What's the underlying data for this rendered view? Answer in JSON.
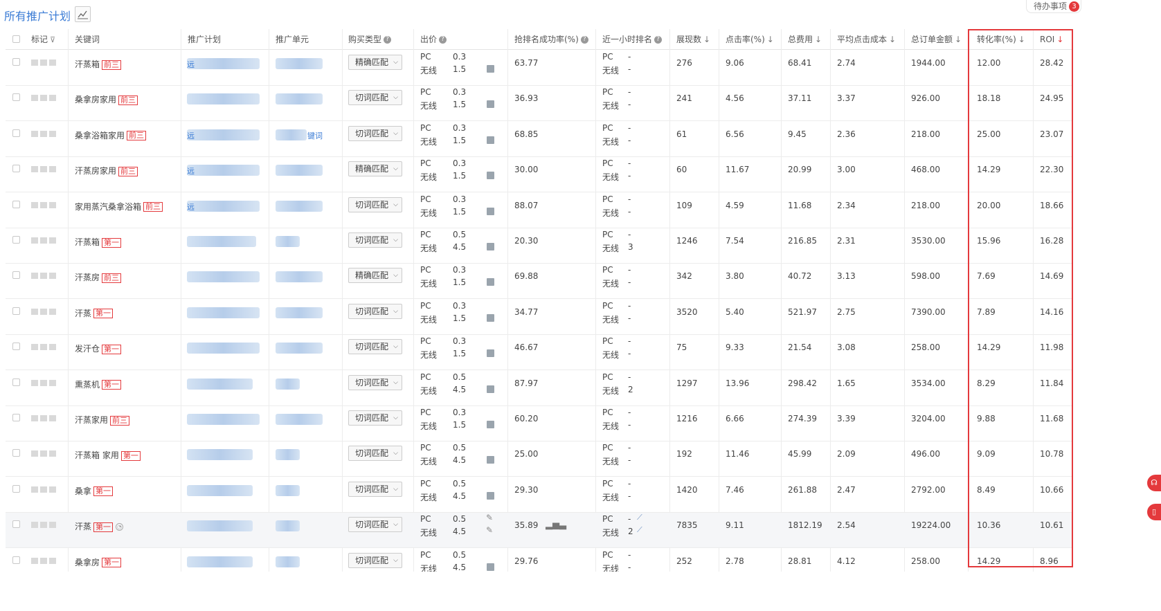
{
  "header": {
    "title": "所有推广计划",
    "chart_icon": "line-chart-icon",
    "todo_label": "待办事项",
    "todo_count": "3"
  },
  "columns": {
    "mark": "标记",
    "keyword": "关键词",
    "plan": "推广计划",
    "unit": "推广单元",
    "match": "购买类型",
    "bid": "出价",
    "rank_rate": "抢排名成功率(%)",
    "hour_rank": "近一小时排名",
    "impressions": "展现数",
    "ctr": "点击率(%)",
    "cost": "总费用",
    "cpc": "平均点击成本",
    "order_amount": "总订单金额",
    "cvr": "转化率(%)",
    "roi": "ROI"
  },
  "labels": {
    "pc": "PC",
    "wireless": "无线",
    "dash": "-"
  },
  "rows": [
    {
      "keyword": "汗蒸箱",
      "tag": "前三",
      "plan_hint": "远",
      "unit_hint": "",
      "match": "精确匹配",
      "bid_pc": "0.3",
      "bid_wl": "1.5",
      "rank_rate": "63.77",
      "rank_pc": "-",
      "rank_wl": "-",
      "impressions": "276",
      "ctr": "9.06",
      "cost": "68.41",
      "cpc": "2.74",
      "order_amount": "1944.00",
      "cvr": "12.00",
      "roi": "28.42"
    },
    {
      "keyword": "桑拿房家用",
      "tag": "前三",
      "plan_hint": "",
      "unit_hint": "",
      "match": "切词匹配",
      "bid_pc": "0.3",
      "bid_wl": "1.5",
      "rank_rate": "36.93",
      "rank_pc": "-",
      "rank_wl": "-",
      "impressions": "241",
      "ctr": "4.56",
      "cost": "37.11",
      "cpc": "3.37",
      "order_amount": "926.00",
      "cvr": "18.18",
      "roi": "24.95"
    },
    {
      "keyword": "桑拿浴箱家用",
      "tag": "前三",
      "plan_hint": "远",
      "unit_hint": "键词",
      "match": "切词匹配",
      "bid_pc": "0.3",
      "bid_wl": "1.5",
      "rank_rate": "68.85",
      "rank_pc": "-",
      "rank_wl": "-",
      "impressions": "61",
      "ctr": "6.56",
      "cost": "9.45",
      "cpc": "2.36",
      "order_amount": "218.00",
      "cvr": "25.00",
      "roi": "23.07"
    },
    {
      "keyword": "汗蒸房家用",
      "tag": "前三",
      "plan_hint": "远",
      "unit_hint": "",
      "match": "精确匹配",
      "bid_pc": "0.3",
      "bid_wl": "1.5",
      "rank_rate": "30.00",
      "rank_pc": "-",
      "rank_wl": "-",
      "impressions": "60",
      "ctr": "11.67",
      "cost": "20.99",
      "cpc": "3.00",
      "order_amount": "468.00",
      "cvr": "14.29",
      "roi": "22.30"
    },
    {
      "keyword": "家用蒸汽桑拿浴箱",
      "tag": "前三",
      "plan_hint": "远",
      "unit_hint": "",
      "match": "切词匹配",
      "bid_pc": "0.3",
      "bid_wl": "1.5",
      "rank_rate": "88.07",
      "rank_pc": "-",
      "rank_wl": "-",
      "impressions": "109",
      "ctr": "4.59",
      "cost": "11.68",
      "cpc": "2.34",
      "order_amount": "218.00",
      "cvr": "20.00",
      "roi": "18.66"
    },
    {
      "keyword": "汗蒸箱",
      "tag": "第一",
      "plan_hint": "",
      "unit_hint": "",
      "match": "切词匹配",
      "bid_pc": "0.5",
      "bid_wl": "4.5",
      "rank_rate": "20.30",
      "rank_pc": "-",
      "rank_wl": "3",
      "impressions": "1246",
      "ctr": "7.54",
      "cost": "216.85",
      "cpc": "2.31",
      "order_amount": "3530.00",
      "cvr": "15.96",
      "roi": "16.28"
    },
    {
      "keyword": "汗蒸房",
      "tag": "前三",
      "plan_hint": "",
      "unit_hint": "",
      "match": "精确匹配",
      "bid_pc": "0.3",
      "bid_wl": "1.5",
      "rank_rate": "69.88",
      "rank_pc": "-",
      "rank_wl": "-",
      "impressions": "342",
      "ctr": "3.80",
      "cost": "40.72",
      "cpc": "3.13",
      "order_amount": "598.00",
      "cvr": "7.69",
      "roi": "14.69"
    },
    {
      "keyword": "汗蒸",
      "tag": "第一",
      "plan_hint": "",
      "unit_hint": "",
      "match": "切词匹配",
      "bid_pc": "0.3",
      "bid_wl": "1.5",
      "rank_rate": "34.77",
      "rank_pc": "-",
      "rank_wl": "-",
      "impressions": "3520",
      "ctr": "5.40",
      "cost": "521.97",
      "cpc": "2.75",
      "order_amount": "7390.00",
      "cvr": "7.89",
      "roi": "14.16"
    },
    {
      "keyword": "发汗仓",
      "tag": "第一",
      "plan_hint": "",
      "unit_hint": "",
      "match": "切词匹配",
      "bid_pc": "0.3",
      "bid_wl": "1.5",
      "rank_rate": "46.67",
      "rank_pc": "-",
      "rank_wl": "-",
      "impressions": "75",
      "ctr": "9.33",
      "cost": "21.54",
      "cpc": "3.08",
      "order_amount": "258.00",
      "cvr": "14.29",
      "roi": "11.98"
    },
    {
      "keyword": "熏蒸机",
      "tag": "第一",
      "plan_hint": "",
      "unit_hint": "",
      "match": "切词匹配",
      "bid_pc": "0.5",
      "bid_wl": "4.5",
      "rank_rate": "87.97",
      "rank_pc": "-",
      "rank_wl": "2",
      "impressions": "1297",
      "ctr": "13.96",
      "cost": "298.42",
      "cpc": "1.65",
      "order_amount": "3534.00",
      "cvr": "8.29",
      "roi": "11.84"
    },
    {
      "keyword": "汗蒸家用",
      "tag": "前三",
      "plan_hint": "",
      "unit_hint": "",
      "match": "切词匹配",
      "bid_pc": "0.3",
      "bid_wl": "1.5",
      "rank_rate": "60.20",
      "rank_pc": "-",
      "rank_wl": "-",
      "impressions": "1216",
      "ctr": "6.66",
      "cost": "274.39",
      "cpc": "3.39",
      "order_amount": "3204.00",
      "cvr": "9.88",
      "roi": "11.68"
    },
    {
      "keyword": "汗蒸箱 家用",
      "tag": "第一",
      "plan_hint": "",
      "unit_hint": "",
      "match": "切词匹配",
      "bid_pc": "0.5",
      "bid_wl": "4.5",
      "rank_rate": "25.00",
      "rank_pc": "-",
      "rank_wl": "-",
      "impressions": "192",
      "ctr": "11.46",
      "cost": "45.99",
      "cpc": "2.09",
      "order_amount": "496.00",
      "cvr": "9.09",
      "roi": "10.78"
    },
    {
      "keyword": "桑拿",
      "tag": "第一",
      "plan_hint": "",
      "unit_hint": "",
      "match": "切词匹配",
      "bid_pc": "0.5",
      "bid_wl": "4.5",
      "rank_rate": "29.30",
      "rank_pc": "-",
      "rank_wl": "-",
      "impressions": "1420",
      "ctr": "7.46",
      "cost": "261.88",
      "cpc": "2.47",
      "order_amount": "2792.00",
      "cvr": "8.49",
      "roi": "10.66"
    },
    {
      "keyword": "汗蒸",
      "tag": "第一",
      "plan_hint": "",
      "unit_hint": "",
      "match": "切词匹配",
      "bid_pc": "0.5",
      "bid_wl": "4.5",
      "rank_rate": "35.89",
      "rank_pc": "-",
      "rank_wl": "2",
      "impressions": "7835",
      "ctr": "9.11",
      "cost": "1812.19",
      "cpc": "2.54",
      "order_amount": "19224.00",
      "cvr": "10.36",
      "roi": "10.61"
    },
    {
      "keyword": "桑拿房",
      "tag": "第一",
      "plan_hint": "",
      "unit_hint": "",
      "match": "切词匹配",
      "bid_pc": "0.5",
      "bid_wl": "4.5",
      "rank_rate": "29.76",
      "rank_pc": "-",
      "rank_wl": "-",
      "impressions": "252",
      "ctr": "2.78",
      "cost": "28.81",
      "cpc": "4.12",
      "order_amount": "258.00",
      "cvr": "14.29",
      "roi": "8.96"
    }
  ],
  "highlight_color": "#e4393c"
}
